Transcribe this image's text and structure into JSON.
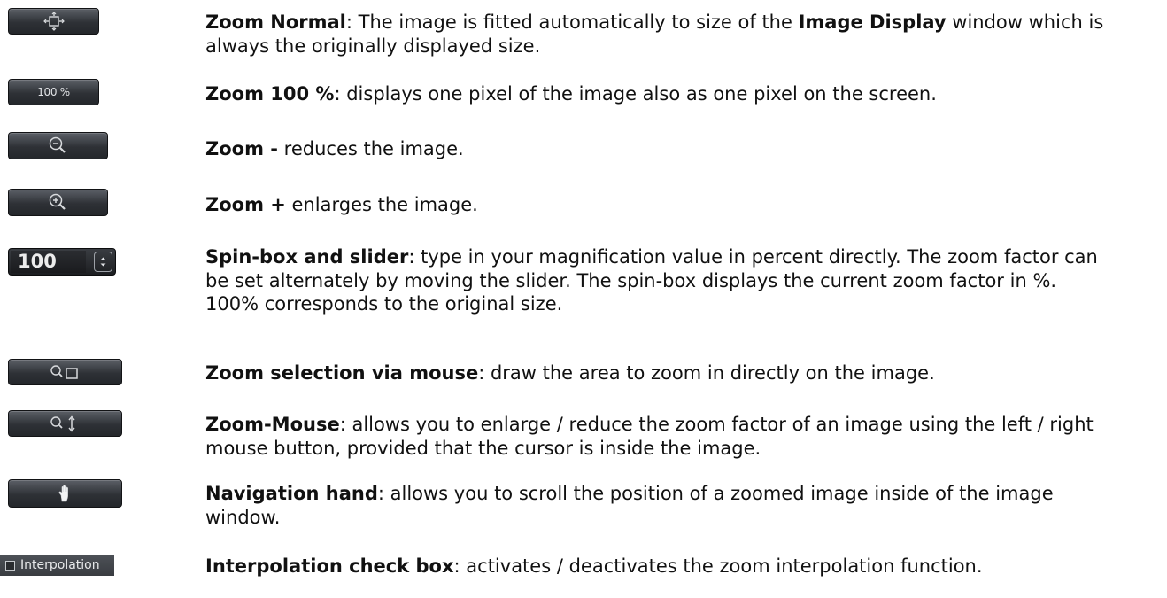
{
  "rows": [
    {
      "control": {
        "icon": "zoom-normal-icon"
      },
      "title": "Zoom Normal",
      "parts": [
        ": The image is fitted automatically to size of the ",
        "Image Display",
        " window which is always the originally displayed size."
      ]
    },
    {
      "control": {
        "label": "100 %"
      },
      "title": "Zoom 100 %",
      "parts": [
        ": displays one pixel of the image also as one pixel on the screen."
      ]
    },
    {
      "control": {
        "icon": "zoom-out-icon"
      },
      "title": "Zoom -",
      "parts": [
        " reduces the image."
      ]
    },
    {
      "control": {
        "icon": "zoom-in-icon"
      },
      "title": "Zoom +",
      "parts": [
        " enlarges the image."
      ]
    },
    {
      "control": {
        "value": "100",
        "icon": "spin-arrows-icon"
      },
      "title": "Spin-box and slider",
      "parts": [
        ": type in your magnification value in percent directly. The zoom factor can be set alternately by moving the slider. The spin-box displays the current zoom factor in %. 100% corresponds to the original size."
      ]
    },
    {
      "control": {
        "icon": "zoom-selection-icon"
      },
      "title": "Zoom selection via mouse",
      "parts": [
        ": draw the area to zoom in directly on the image."
      ]
    },
    {
      "control": {
        "icon": "zoom-mouse-icon"
      },
      "title": "Zoom-Mouse",
      "parts": [
        ": allows you to enlarge / reduce the zoom factor of an image using the left / right mouse button, provided that the cursor is inside the image."
      ]
    },
    {
      "control": {
        "icon": "hand-icon"
      },
      "title": "Navigation hand",
      "parts": [
        ": allows you to scroll the position of a zoomed image inside of the image window."
      ]
    },
    {
      "control": {
        "label": "Interpolation",
        "checked": false
      },
      "title": "Interpolation check box",
      "parts": [
        ": activates / deactivates the zoom interpolation function."
      ]
    }
  ],
  "colors": {
    "button_dark": "#2e3136",
    "button_light": "#5b5f66",
    "icon": "#d8dadd",
    "text": "#111111"
  }
}
